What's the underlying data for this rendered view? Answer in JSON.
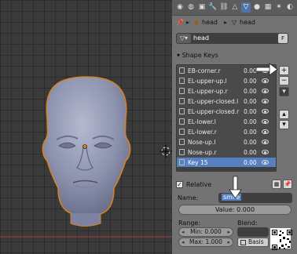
{
  "viewport": {
    "colors": {
      "skin": "#8c92ad",
      "outline": "#d9831f",
      "grid": "#3a3a3a"
    }
  },
  "header": {
    "tabs": [
      "scene-icon",
      "world-icon",
      "object-icon",
      "modifier-icon",
      "mesh-data-icon",
      "material-icon",
      "texture-icon",
      "particles-icon",
      "physics-icon"
    ]
  },
  "breadcrumb": {
    "object": "head",
    "mesh": "head"
  },
  "datablock": {
    "name": "head",
    "fake_user": "F"
  },
  "shape_keys": {
    "title": "Shape Keys",
    "items": [
      {
        "name": "EB-corner.r",
        "value": "0.00"
      },
      {
        "name": "EL-upper-up.l",
        "value": "0.00"
      },
      {
        "name": "EL-upper-up.r",
        "value": "0.00"
      },
      {
        "name": "EL-upper-closed.l",
        "value": "0.00"
      },
      {
        "name": "EL-upper-closed.r",
        "value": "0.00"
      },
      {
        "name": "EL-lower.l",
        "value": "0.00"
      },
      {
        "name": "EL-lower.r",
        "value": "0.00"
      },
      {
        "name": "Nose-up.l",
        "value": "0.00"
      },
      {
        "name": "Nose-up.r",
        "value": "0.00"
      },
      {
        "name": "Key 15",
        "value": "0.00",
        "selected": true
      }
    ],
    "side_buttons": [
      "+",
      "−",
      "▾",
      "▴",
      "▾"
    ]
  },
  "relative": {
    "label": "Relative",
    "checked": true
  },
  "name_field": {
    "label": "Name:",
    "value": "smile"
  },
  "value_slider": {
    "text": "Value: 0.000"
  },
  "range": {
    "label": "Range:",
    "min": "Min: 0.000",
    "max": "Max: 1.000"
  },
  "blend": {
    "label": "Blend:",
    "basis": "Basis"
  },
  "accent": {
    "selection": "#5680c2",
    "arrow": "#ffffff"
  }
}
